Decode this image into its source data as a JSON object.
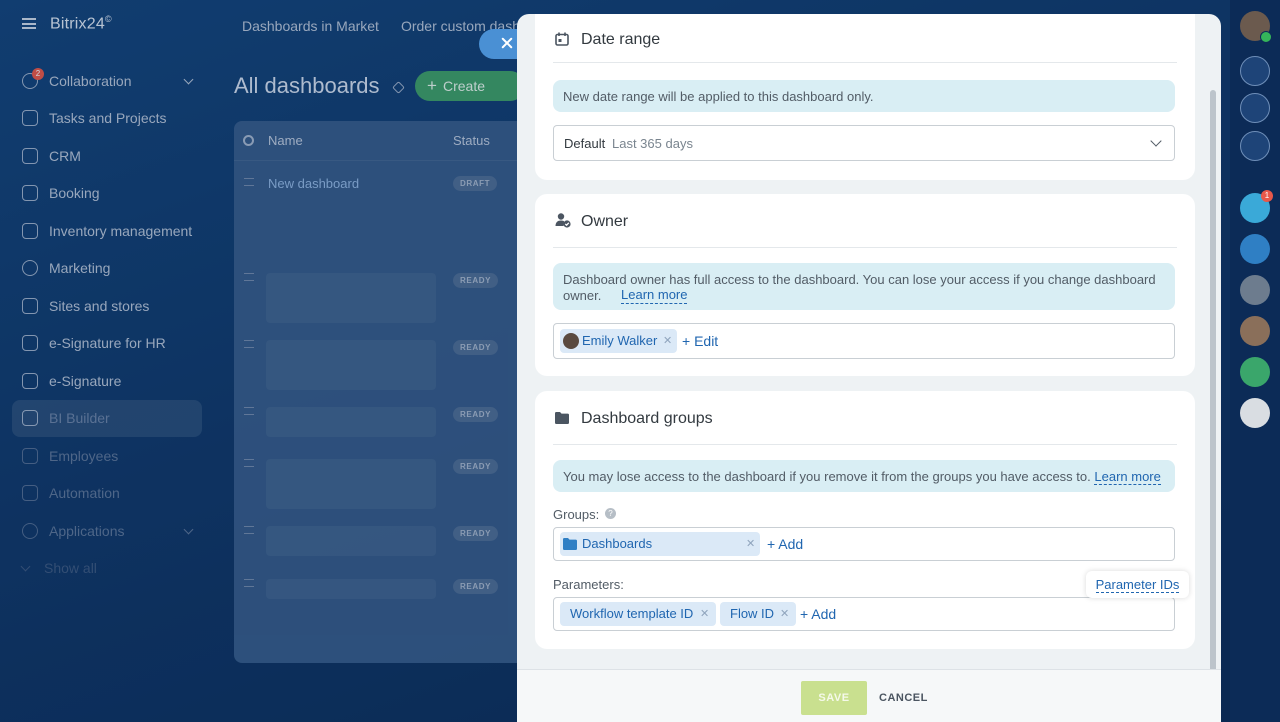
{
  "app": {
    "brand": "Bitrix24",
    "brand_mark": "©",
    "top_nav": [
      "Dashboards in Market",
      "Order custom dash"
    ]
  },
  "sidebar": {
    "collaboration_badge": "2",
    "items": [
      {
        "label": "Collaboration"
      },
      {
        "label": "Tasks and Projects"
      },
      {
        "label": "CRM"
      },
      {
        "label": "Booking"
      },
      {
        "label": "Inventory management"
      },
      {
        "label": "Marketing"
      },
      {
        "label": "Sites and stores"
      },
      {
        "label": "e-Signature for HR"
      },
      {
        "label": "e-Signature"
      },
      {
        "label": "BI Builder"
      },
      {
        "label": "Employees"
      },
      {
        "label": "Automation"
      },
      {
        "label": "Applications"
      },
      {
        "label": "Show all"
      }
    ]
  },
  "main": {
    "title": "All dashboards",
    "create_label": "Create",
    "columns": [
      "Name",
      "Status"
    ],
    "rows": [
      {
        "name": "New dashboard",
        "status": "DRAFT"
      },
      {
        "name": "",
        "status": "READY"
      },
      {
        "name": "",
        "status": "READY"
      },
      {
        "name": "",
        "status": "READY"
      },
      {
        "name": "",
        "status": "READY"
      },
      {
        "name": "",
        "status": "READY"
      },
      {
        "name": "",
        "status": "READY"
      }
    ]
  },
  "rail": {
    "chat_badge": "1"
  },
  "panel": {
    "date_range": {
      "title": "Date range",
      "info": "New date range will be applied to this dashboard only.",
      "select_default": "Default",
      "select_value": "Last 365 days"
    },
    "owner": {
      "title": "Owner",
      "info": "Dashboard owner has full access to the dashboard. You can lose your access if you change dashboard owner.",
      "learn_more": "Learn more",
      "owner_name": "Emily Walker",
      "edit_label": "+ Edit"
    },
    "groups": {
      "title": "Dashboard groups",
      "info": "You may lose access to the dashboard if you remove it from the groups you have access to.",
      "learn_more": "Learn more",
      "groups_label": "Groups:",
      "group_chip": "Dashboards",
      "add_label": "+ Add",
      "parameters_label": "Parameters:",
      "parameter_ids_link": "Parameter IDs",
      "parameters": [
        "Workflow template ID",
        "Flow ID"
      ],
      "param_add_label": "+ Add"
    },
    "footer": {
      "save_label": "SAVE",
      "cancel_label": "CANCEL"
    }
  },
  "colors": {
    "accent_link": "#2066b0",
    "save_disabled": "#c9e08f",
    "info_box": "#d9eef4",
    "create_green": "#3f9f6a"
  }
}
